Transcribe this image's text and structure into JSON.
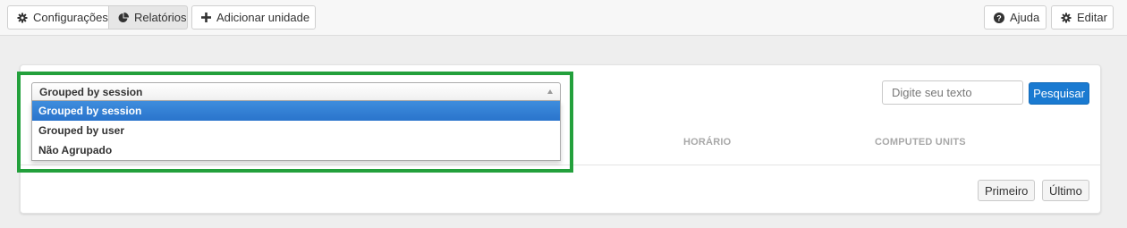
{
  "toolbar": {
    "configuracoes_label": "Configurações",
    "relatorios_label": "Relatórios",
    "adicionar_label": "Adicionar unidade",
    "ajuda_label": "Ajuda",
    "editar_label": "Editar"
  },
  "report": {
    "grouping_select": {
      "selected": "Grouped by session",
      "options": [
        "Grouped by session",
        "Grouped by user",
        "Não Agrupado"
      ],
      "highlighted_index": 0
    },
    "search": {
      "placeholder": "Digite seu texto",
      "button_label": "Pesquisar"
    },
    "columns": [
      "HORÁRIO",
      "COMPUTED UNITS"
    ],
    "pagination": {
      "first_label": "Primeiro",
      "last_label": "Último"
    }
  },
  "colors": {
    "highlight_frame": "#23a03c",
    "primary_button": "#1a7ad1",
    "selected_option": "#3e8ddd"
  },
  "icons": [
    "gear-icon",
    "pie-chart-icon",
    "plus-icon",
    "question-circle-icon"
  ]
}
